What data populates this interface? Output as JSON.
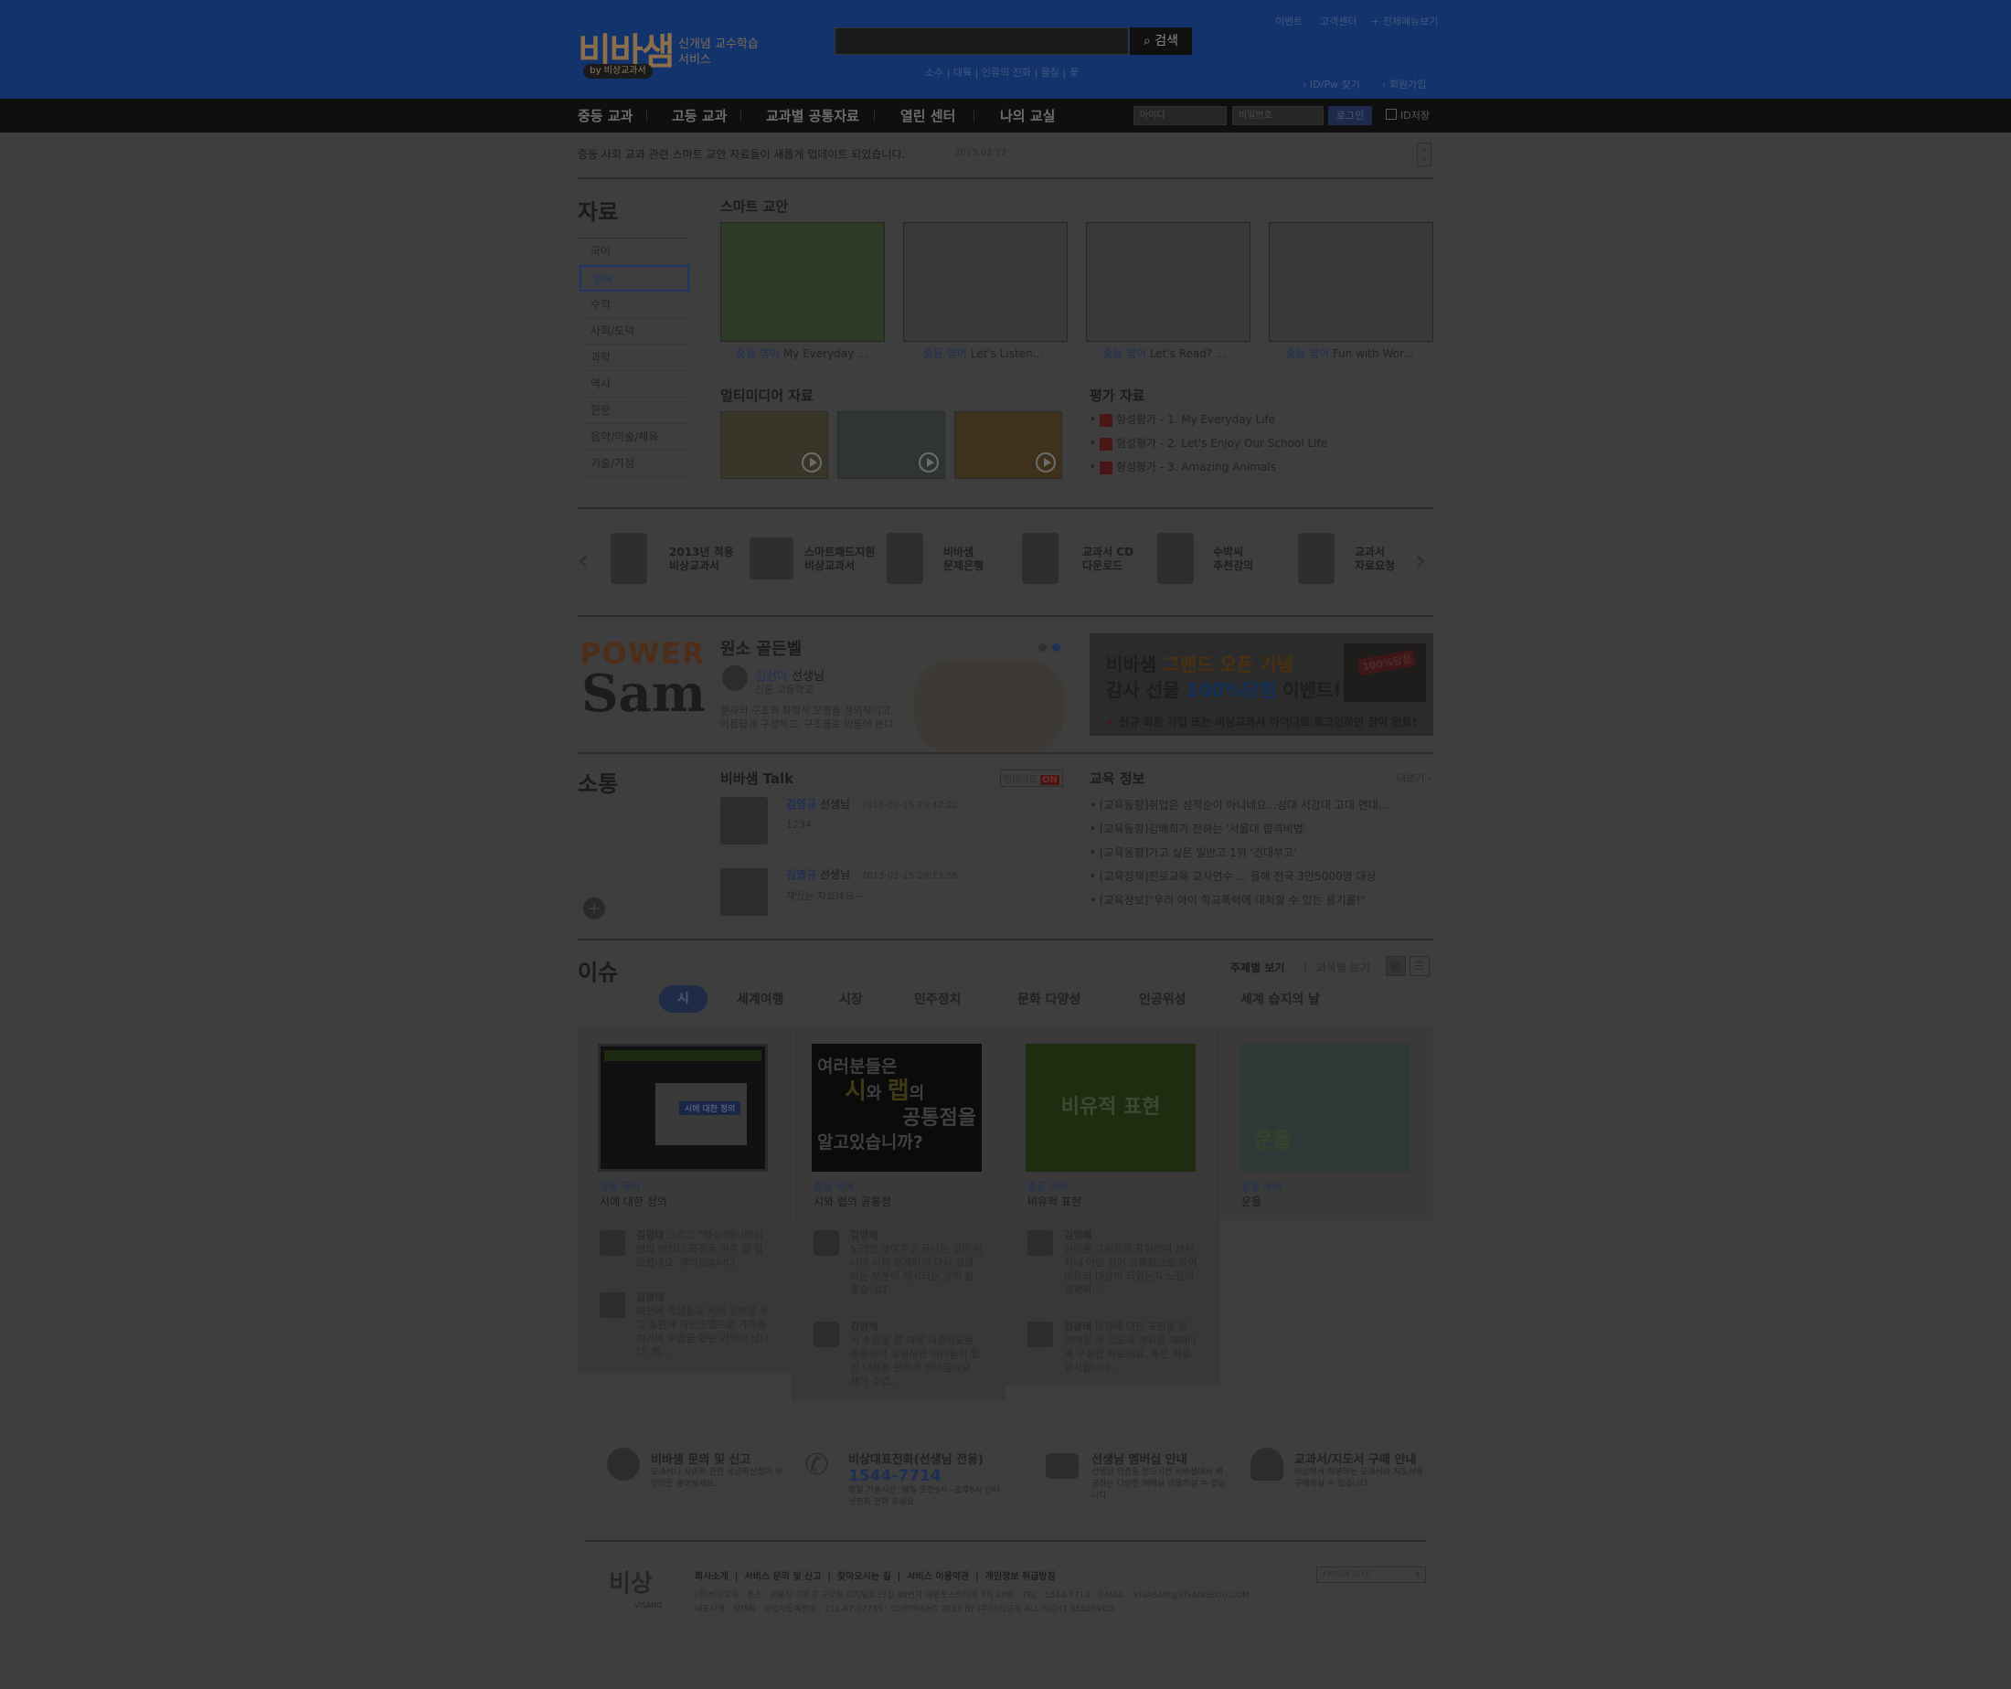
{
  "header": {
    "logo_main": "비바샘",
    "logo_sub": "신개념 교수학습 서비스",
    "logo_by": "by 비상교과서",
    "search_btn": "검색",
    "search_tags": "소수  |  대륙  |  인류의 진화  |  몰질  |  꽃",
    "top_links": [
      "이벤트",
      "고객센터",
      "+ 전체메뉴보기"
    ],
    "sub_links": [
      "ID/Pw 찾기",
      "회원가입"
    ]
  },
  "nav": {
    "items": [
      "중등 교과",
      "고등 교과",
      "교과별 공통자료",
      "열린 센터",
      "나의 교실"
    ],
    "login": {
      "id_placeholder": "아이디",
      "pw_placeholder": "비밀번호",
      "btn": "로그인",
      "save": "ID저장"
    }
  },
  "notice": {
    "text": "중등 사회 교과 관련 스마트 교안 자료들이 새롭게 업데이트 되었습니다.",
    "date": "2013.02.12"
  },
  "resources": {
    "title": "자료",
    "categories": [
      "국어",
      "영어",
      "수학",
      "사회/도덕",
      "과학",
      "역사",
      "한문",
      "음악/미술/체육",
      "기술/가정"
    ],
    "smart_title": "스마트 교안",
    "smart_items": [
      {
        "subj": "중등 영어",
        "title": "My Everyday ..."
      },
      {
        "subj": "중등 영어",
        "title": "Let's Listen..."
      },
      {
        "subj": "중등 영어",
        "title": "Let's Read? ..."
      },
      {
        "subj": "중등 영어",
        "title": "Fun with Wor..."
      }
    ],
    "multimedia_title": "멀티미디어 자료",
    "eval_title": "평가 자료",
    "eval_items": [
      "형성평가 - 1. My Everyday Life",
      "형성평가 - 2. Let's Enjoy Our School Life",
      "형성평가 - 3. Amazing Animals"
    ]
  },
  "quick": [
    {
      "l1": "2013년 적용",
      "l2": "비상교과서"
    },
    {
      "l1": "스마트패드지원",
      "l2": "비상교과서"
    },
    {
      "l1": "비바샘",
      "l2": "문제은행"
    },
    {
      "l1": "교과서 CD",
      "l2": "다운로드"
    },
    {
      "l1": "수박씨",
      "l2": "추천강의"
    },
    {
      "l1": "교과서",
      "l2": "자료요청"
    }
  ],
  "power": {
    "logo1": "POWER",
    "logo2": "Sam",
    "title": "원소 골든벨",
    "teacher": "김선아",
    "teacher_suffix": "선생님",
    "school": "신론 고등학교",
    "desc1": "분자의 구조와 화학식 모형을 정의적이고,",
    "desc2": "아름답게 구성하고, 구조물로 만들어 본다."
  },
  "banner": {
    "line1a": "비바샘 ",
    "line1b": "그랜드 오픈 기념",
    "line2a": "감사 선물 ",
    "line2b": "100%당첨",
    "line2c": " 이벤트!",
    "note": "신규 회원 가입 또는 비상교과서 아이디로 로그인하면 참여 완료!",
    "badge": "100%당첨"
  },
  "comm": {
    "title": "소통",
    "talk_title": "비바샘 Talk",
    "update": "업데이트",
    "on": "ON",
    "talks": [
      {
        "name": "김영규",
        "suffix": "선생님",
        "date": "2013-02-15 23:42:22",
        "msg": "1234"
      },
      {
        "name": "김영규",
        "suffix": "선생님",
        "date": "2013-02-15 20:13:58",
        "msg": "재밌는 자료네요~"
      }
    ],
    "edu_title": "교육 정보",
    "more": "더보기",
    "edu_items": [
      "[교육동향]취업은 성적순이 아니네요...성대 서강대 고대 연대...",
      "[교육동향]김배희가 전하는 '서울대 합격비법'",
      "[교육동향]가고 싶은 일반고 1위 '건대부고'",
      "[교육정책]진로교육 교사연수 ... 올해 전국 3만5000명 대상",
      "[교육정보]\"우리 아이 학교폭력에 대처할 수 있는 용기를!\""
    ]
  },
  "issue": {
    "title": "이슈",
    "view1": "주제별 보기",
    "view2": "과목별 보기",
    "tabs": [
      "시",
      "세계여행",
      "시장",
      "민주정치",
      "문화 다양성",
      "인공위성",
      "세계 습지의 날"
    ],
    "cards": [
      {
        "subj": "중등 국어",
        "title": "시에 대한 정의",
        "img_text": "시에 대한 정의"
      },
      {
        "subj": "중등 국어",
        "title": "시와 랩의 공통점",
        "img_l1": "여러분들은",
        "img_l2a": "시",
        "img_l2b": "와 ",
        "img_l2c": "랩",
        "img_l2d": "의",
        "img_l3": "공통점을",
        "img_l4": "알고있습니까?"
      },
      {
        "subj": "중등 국어",
        "title": "비유적 표현",
        "img_text": "비유적 표현"
      },
      {
        "subj": "중등 국어",
        "title": "운율",
        "img_text": "운율"
      }
    ],
    "comments": [
      [
        {
          "name": "김광태",
          "text": "그리고 \"향수\"에니메이션의 캐릭터 특징을 아주 잘 잡으셨네요. 재미있습니다."
        },
        {
          "name": "김광태",
          "text": "예전에 학생들과 시의 정의를 두고 칠판에 마인드맵으로 가지를 쳐가며 수업을 했던 기억이 납니다. 학..."
        }
      ],
      [
        {
          "name": "김영혜",
          "text": "노래만 보여주고 끝나는 것이 아니라 시와 연계하여 다시 설명 하는 부분이 제시되는 것이 참 좋습니다."
        },
        {
          "name": "김영혜",
          "text": "시 수업을 할 때에 대중가요를 활용하여 설명하면 아이들이 훨씬 내용을 편하게 받아들여요. 제가 수업..."
        }
      ],
      [
        {
          "name": "김영혜",
          "text": "단어를 그림으로 표현하여 제시하니 어떤 점이 공통점으로 묶여 비유의 대상이 되었는지 느낌이 명확히..."
        },
        {
          "name": "김광태",
          "text": "비유에 대한 표현을 잘 이해할 수 있도록 예시를 재미나게 구성한 자료네요. 좋은 자료 감사합니다."
        }
      ]
    ]
  },
  "support": [
    {
      "title": "비바샘 문의 및 신고",
      "sub": "교과서나 사이트 관련 궁금하신점이 무엇이든 물어보세요."
    },
    {
      "title": "비상대표전화(선생님 전용)",
      "phone": "1544-7714",
      "sub": "평일 기술시간: 평일 오전9시~오후6시 인터넷전화 전화 주세요."
    },
    {
      "title": "선생님 멤버십 안내",
      "sub": "선생님 인증을 받으시면 비바샘에서 제공하는 다양한 혜택을 이용하실 수 있습니다."
    },
    {
      "title": "교과서/지도서 구매 안내",
      "sub": "비상에서 제공하는 교과서와 지도서를 구매하실 수 있습니다."
    }
  ],
  "footer": {
    "links": [
      "회사소개",
      "서비스 문의 및 신고",
      "찾아오시는 길",
      "서비스 이용약관",
      "개인정보 취급방침"
    ],
    "addr": "(주)비상교육  ·  주소 : 서울시 구로구 구로동 디지털로33길 48번지 대륭포스트타워 7차 20층  ·  TEL : 1544-7714  ·  E-MAIL : VIVASAM@VISANGEDU.COM",
    "biz": "대표자명 : 양태회  ·  사업자등록번호 : 211-87-07735  ·  COPYRIGHT 2013 BY (주)비상교육 ALL RIGHT RESERVED.",
    "family": "FAMILY SITE",
    "logo": "비상",
    "logo_sub": "VISANG"
  },
  "colors": {
    "header_bg": "#12336b",
    "nav_bg": "#0f0f0f",
    "page_bg": "#3e3e3e",
    "accent_blue": "#1e2f55"
  }
}
